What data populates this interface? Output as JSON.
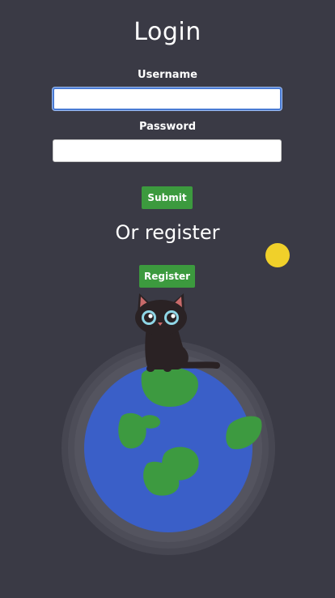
{
  "login": {
    "title": "Login",
    "username_label": "Username",
    "username_value": "",
    "password_label": "Password",
    "password_value": "",
    "submit_label": "Submit"
  },
  "register": {
    "heading": "Or register",
    "button_label": "Register"
  },
  "illustration": {
    "sun_icon": "sun-icon",
    "cat_icon": "cat-icon",
    "planet_icon": "earth-planet-icon"
  },
  "colors": {
    "background": "#3a3a45",
    "button": "#3c9a3e",
    "sun": "#f0d02a",
    "ocean": "#3a5fc8",
    "land": "#3d9a40",
    "cat": "#2a2224"
  }
}
